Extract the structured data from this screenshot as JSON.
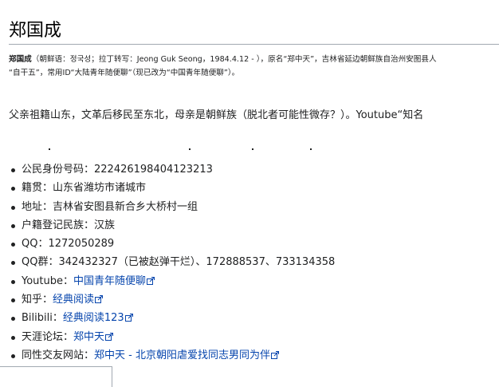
{
  "title": "郑国成",
  "intro": {
    "name": "郑国成",
    "line1_rest": "（朝鲜语：정국성；拉丁转写：Jeong Guk Seong，1984.4.12 - ），原名“郑中天”，吉林省延边朝鲜族自治州安图县人",
    "line2": "“自干五”，常用ID“大陆青年随便聊”（现已改为“中国青年随便聊”）。"
  },
  "paragraph": "父亲祖籍山东，文革后移民至东北，母亲是朝鲜族（脱北者可能性微存？）。Youtube“知名",
  "facts": [
    {
      "label": "公民身份号码：",
      "value": "222426198404123213"
    },
    {
      "label": "籍贯：",
      "value": "山东省潍坊市诸城市"
    },
    {
      "label": "地址：",
      "value": "吉林省安图县新合乡大桥村一组"
    },
    {
      "label": "户籍登记民族：",
      "value": "汉族"
    },
    {
      "label": "QQ：",
      "value": "1272050289"
    },
    {
      "label": "QQ群：",
      "value": "342432327（已被赵弹干烂）、172888537、733134358"
    }
  ],
  "links": [
    {
      "label": "Youtube：",
      "link": "中国青年随便聊"
    },
    {
      "label": "知乎：",
      "link": "经典阅读"
    },
    {
      "label": "Bilibili：",
      "link": "经典阅读123"
    },
    {
      "label": "天涯论坛：",
      "link": "郑中天"
    },
    {
      "label": "同性交友网站：",
      "link": "郑中天 - 北京朝阳虐爱找同志男同为伴"
    }
  ],
  "colors": {
    "link": "#0645ad",
    "text": "#202122",
    "rule": "#a2a9b1"
  },
  "icons": {
    "external_link": "external-link-icon"
  }
}
